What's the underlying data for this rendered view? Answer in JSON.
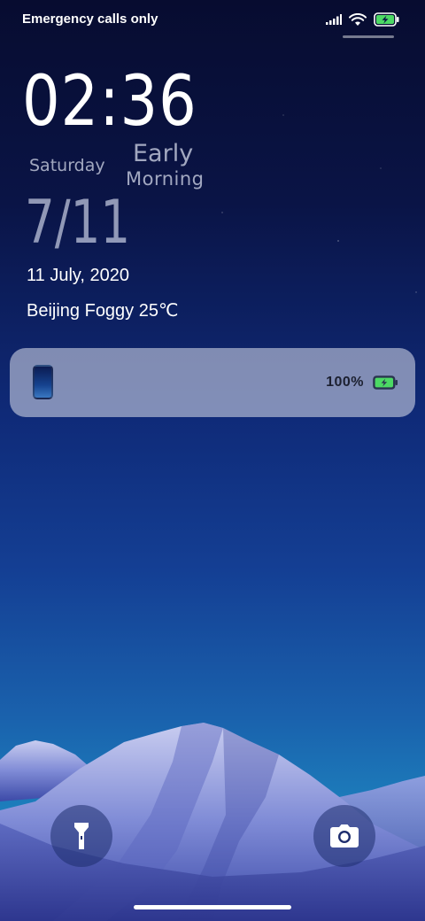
{
  "status_bar": {
    "carrier": "Emergency calls only",
    "icons": [
      "signal-icon",
      "wifi-icon",
      "battery-charging-icon"
    ]
  },
  "clock": {
    "time": "02:36",
    "weekday": "Saturday",
    "period_line1": "Early",
    "period_line2": "Morning",
    "short_date": "7/11",
    "full_date": "11 July, 2020",
    "weather": "Beijing Foggy 25℃"
  },
  "charging_card": {
    "percent": "100%",
    "level": 1.0
  },
  "shortcuts": {
    "left_icon": "flashlight-icon",
    "right_icon": "camera-icon"
  },
  "colors": {
    "battery_green": "#4cd964",
    "card_text": "#1c2030"
  }
}
